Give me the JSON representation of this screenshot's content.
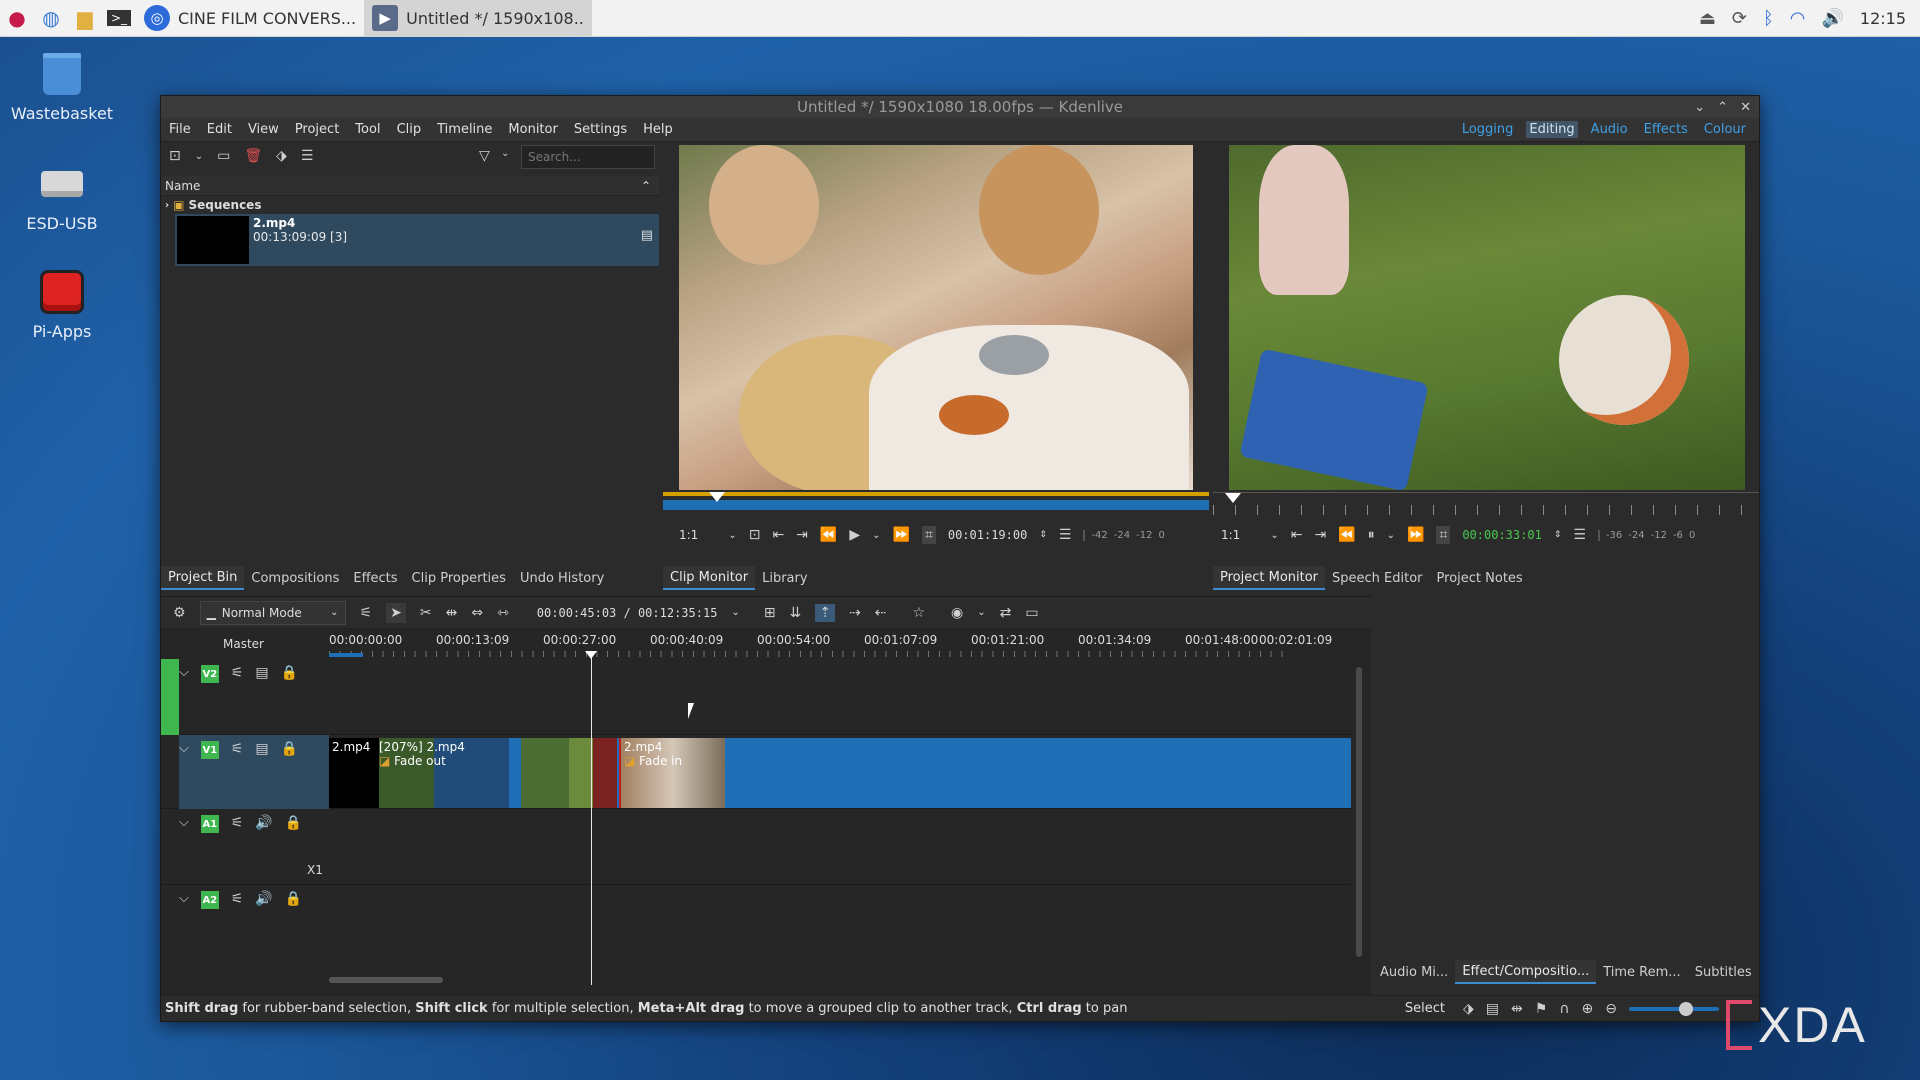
{
  "taskbar": {
    "tasks": [
      {
        "label": "CINE FILM CONVERS..."
      },
      {
        "label": "Untitled */ 1590x108.."
      }
    ],
    "clock": "12:15"
  },
  "desktop": {
    "icons": [
      {
        "label": "Wastebasket"
      },
      {
        "label": "ESD-USB"
      },
      {
        "label": "Pi-Apps"
      }
    ]
  },
  "window": {
    "title": "Untitled */ 1590x1080 18.00fps — Kdenlive",
    "menu": [
      "File",
      "Edit",
      "View",
      "Project",
      "Tool",
      "Clip",
      "Timeline",
      "Monitor",
      "Settings",
      "Help"
    ],
    "layouts": [
      "Logging",
      "Editing",
      "Audio",
      "Effects",
      "Colour"
    ]
  },
  "bin": {
    "search_placeholder": "Search...",
    "column_name": "Name",
    "folder": "Sequences",
    "clip_name": "2.mp4",
    "clip_duration": "00:13:09:09 [3]",
    "tabs": [
      "Project Bin",
      "Compositions",
      "Effects",
      "Clip Properties",
      "Undo History"
    ]
  },
  "clip_monitor": {
    "zoom": "1:1",
    "timecode": "00:01:19:00",
    "meter_labels": [
      "-42",
      "-24",
      "-12",
      "0"
    ],
    "tabs": [
      "Clip Monitor",
      "Library"
    ]
  },
  "project_monitor": {
    "zoom": "1:1",
    "timecode": "00:00:33:01",
    "meter_labels": [
      "-36",
      "-24",
      "-12",
      "-6",
      "0"
    ],
    "tabs": [
      "Project Monitor",
      "Speech Editor",
      "Project Notes"
    ]
  },
  "timeline": {
    "mode": "Normal Mode",
    "position": "00:00:45:03 / 00:12:35:15",
    "master_label": "Master",
    "ruler": [
      "00:00:00:00",
      "00:00:13:09",
      "00:00:27:00",
      "00:00:40:09",
      "00:00:54:00",
      "00:01:07:09",
      "00:01:21:00",
      "00:01:34:09",
      "00:01:48:00",
      "00:02:01:09"
    ],
    "tracks": [
      "V2",
      "V1",
      "A1",
      "A2"
    ],
    "mix_label": "X1",
    "clips": {
      "c1": "2.mp4",
      "c2": "[207%] 2.mp4",
      "c2_effect": "Fade out",
      "c3": "2.mp4",
      "c3_effect": "Fade in"
    }
  },
  "right_panel_tabs": [
    "Audio Mi...",
    "Effect/Compositio...",
    "Time Rem...",
    "Subtitles"
  ],
  "status": {
    "k1": "Shift drag",
    "t1": " for rubber-band selection, ",
    "k2": "Shift click",
    "t2": " for multiple selection, ",
    "k3": "Meta+Alt drag",
    "t3": " to move a grouped clip to another track, ",
    "k4": "Ctrl drag",
    "t4": " to pan",
    "tool": "Select"
  },
  "watermark": "XDA",
  "colors": {
    "accent": "#3d8bd2",
    "track_tag": "#3fb64f",
    "clip_blue": "#1e6fb6"
  }
}
